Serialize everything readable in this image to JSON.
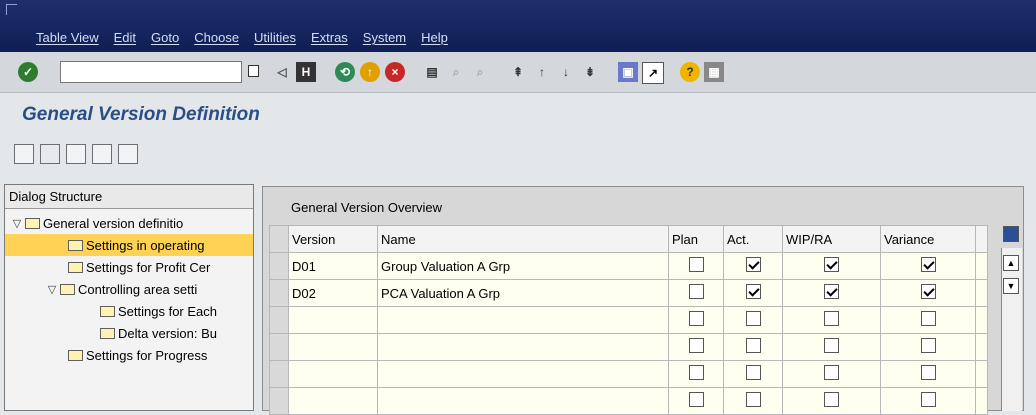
{
  "menu": [
    "Table View",
    "Edit",
    "Goto",
    "Choose",
    "Utilities",
    "Extras",
    "System",
    "Help"
  ],
  "toolbar": {
    "command_field_value": "",
    "icons": [
      "enter-icon",
      "back-icon",
      "save-icon",
      "back-arrow-icon",
      "exit-icon",
      "cancel-icon",
      "print-icon",
      "find-icon",
      "find-next-icon",
      "first-page-icon",
      "previous-page-icon",
      "next-page-icon",
      "last-page-icon",
      "create-session-icon",
      "shortcut-icon",
      "help-icon",
      "layout-icon"
    ]
  },
  "page": {
    "title": "General Version Definition"
  },
  "dialog_structure": {
    "header": "Dialog Structure",
    "items": [
      {
        "label": "General version definitio",
        "level": 0,
        "expanded": true,
        "selected": false
      },
      {
        "label": "Settings in operating",
        "level": 2,
        "selected": true
      },
      {
        "label": "Settings for Profit Cer",
        "level": 2,
        "selected": false
      },
      {
        "label": "Controlling area setti",
        "level": 1,
        "expanded": true,
        "selected": false
      },
      {
        "label": "Settings for Each",
        "level": 3,
        "selected": false
      },
      {
        "label": "Delta version: Bu",
        "level": 3,
        "selected": false
      },
      {
        "label": "Settings for Progress",
        "level": 2,
        "selected": false
      }
    ]
  },
  "overview": {
    "title": "General Version Overview",
    "columns": [
      "Version",
      "Name",
      "Plan",
      "Act.",
      "WIP/RA",
      "Variance",
      ""
    ],
    "rows": [
      {
        "version": "D01",
        "name": "Group Valuation A Grp",
        "plan": false,
        "act": true,
        "wip": true,
        "variance": true
      },
      {
        "version": "D02",
        "name": "PCA Valuation A Grp",
        "plan": false,
        "act": true,
        "wip": true,
        "variance": true
      },
      {
        "version": "",
        "name": "",
        "plan": false,
        "act": false,
        "wip": false,
        "variance": false
      },
      {
        "version": "",
        "name": "",
        "plan": false,
        "act": false,
        "wip": false,
        "variance": false
      },
      {
        "version": "",
        "name": "",
        "plan": false,
        "act": false,
        "wip": false,
        "variance": false
      },
      {
        "version": "",
        "name": "",
        "plan": false,
        "act": false,
        "wip": false,
        "variance": false
      }
    ]
  }
}
